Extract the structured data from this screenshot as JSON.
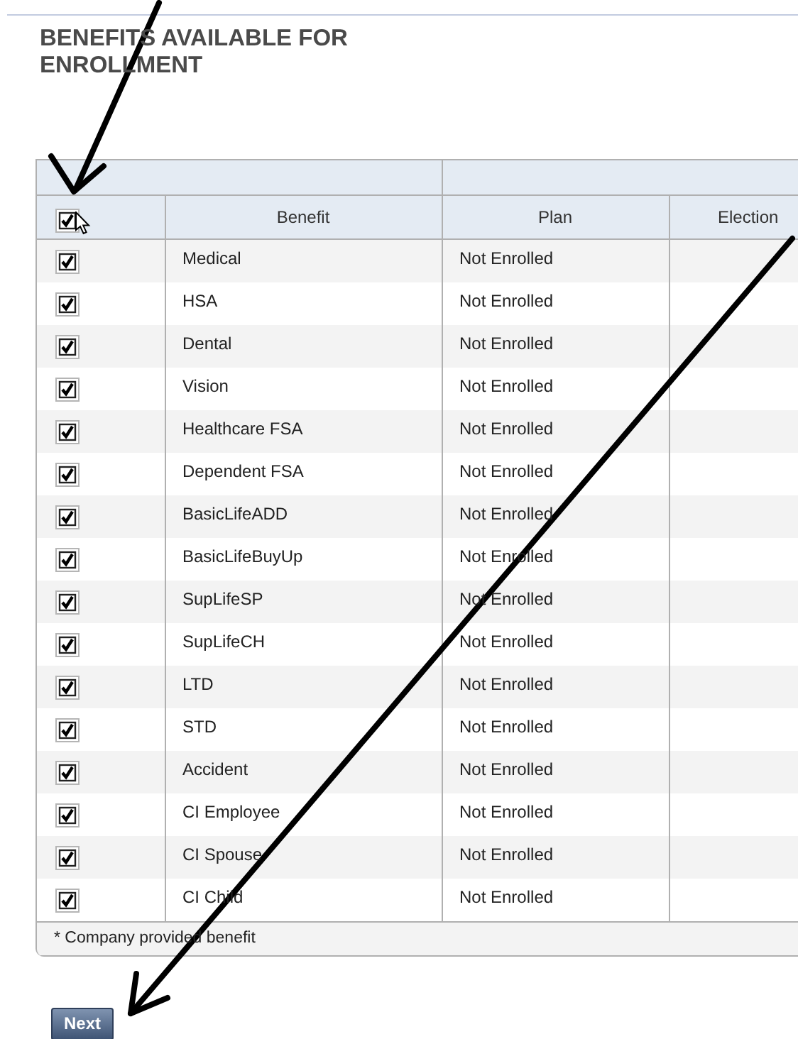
{
  "title": "BENEFITS AVAILABLE FOR ENROLLMENT",
  "table": {
    "header_checkbox": {
      "checked": true
    },
    "columns": [
      "Benefit",
      "Plan",
      "Election"
    ],
    "rows": [
      {
        "benefit": "Medical",
        "plan": "Not Enrolled",
        "checked": true
      },
      {
        "benefit": "HSA",
        "plan": "Not Enrolled",
        "checked": true
      },
      {
        "benefit": "Dental",
        "plan": "Not Enrolled",
        "checked": true
      },
      {
        "benefit": "Vision",
        "plan": "Not Enrolled",
        "checked": true
      },
      {
        "benefit": "Healthcare FSA",
        "plan": "Not Enrolled",
        "checked": true
      },
      {
        "benefit": "Dependent FSA",
        "plan": "Not Enrolled",
        "checked": true
      },
      {
        "benefit": "BasicLifeADD",
        "plan": "Not Enrolled",
        "checked": true
      },
      {
        "benefit": "BasicLifeBuyUp",
        "plan": "Not Enrolled",
        "checked": true
      },
      {
        "benefit": "SupLifeSP",
        "plan": "Not Enrolled",
        "checked": true
      },
      {
        "benefit": "SupLifeCH",
        "plan": "Not Enrolled",
        "checked": true
      },
      {
        "benefit": "LTD",
        "plan": "Not Enrolled",
        "checked": true
      },
      {
        "benefit": "STD",
        "plan": "Not Enrolled",
        "checked": true
      },
      {
        "benefit": "Accident",
        "plan": "Not Enrolled",
        "checked": true
      },
      {
        "benefit": "CI Employee",
        "plan": "Not Enrolled",
        "checked": true
      },
      {
        "benefit": "CI Spouse",
        "plan": "Not Enrolled",
        "checked": true
      },
      {
        "benefit": "CI Child",
        "plan": "Not Enrolled",
        "checked": true
      }
    ],
    "footnote": "* Company provided benefit"
  },
  "next_button": "Next"
}
